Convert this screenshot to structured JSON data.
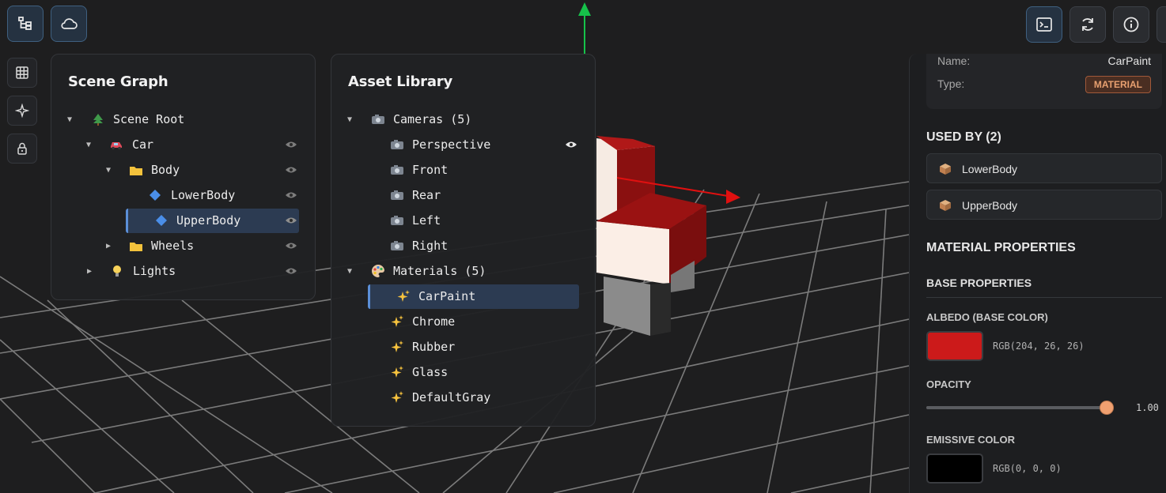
{
  "scene_graph": {
    "title": "Scene Graph",
    "nodes": [
      {
        "label": "Scene Root",
        "icon": "tree-icon"
      },
      {
        "label": "Car",
        "icon": "car-icon"
      },
      {
        "label": "Body",
        "icon": "folder-icon"
      },
      {
        "label": "LowerBody",
        "icon": "diamond-icon"
      },
      {
        "label": "UpperBody",
        "icon": "diamond-icon",
        "selected": true
      },
      {
        "label": "Wheels",
        "icon": "folder-icon"
      },
      {
        "label": "Lights",
        "icon": "bulb-icon"
      }
    ]
  },
  "asset_library": {
    "title": "Asset Library",
    "cameras_group": "Cameras (5)",
    "cameras": [
      "Perspective",
      "Front",
      "Rear",
      "Left",
      "Right"
    ],
    "materials_group": "Materials (5)",
    "materials": [
      "CarPaint",
      "Chrome",
      "Rubber",
      "Glass",
      "DefaultGray"
    ],
    "selected_material": "CarPaint"
  },
  "inspector": {
    "name_label": "Name:",
    "name_value": "CarPaint",
    "type_label": "Type:",
    "type_badge": "MATERIAL",
    "used_by_heading": "USED BY (2)",
    "used_by": [
      "LowerBody",
      "UpperBody"
    ],
    "material_properties_heading": "MATERIAL PROPERTIES",
    "base_properties_heading": "BASE PROPERTIES",
    "albedo_label": "ALBEDO (BASE COLOR)",
    "albedo_value": "RGB(204, 26, 26)",
    "albedo_color": "#cc1a1a",
    "opacity_label": "OPACITY",
    "opacity_value": "1.00",
    "opacity_fraction": 1.0,
    "emissive_label": "EMISSIVE COLOR",
    "emissive_value": "RGB(0, 0, 0)",
    "emissive_color": "#000000"
  },
  "colors": {
    "accent": "#5b8fd8",
    "badge": "#e8a070",
    "slider_thumb": "#f0a070"
  }
}
